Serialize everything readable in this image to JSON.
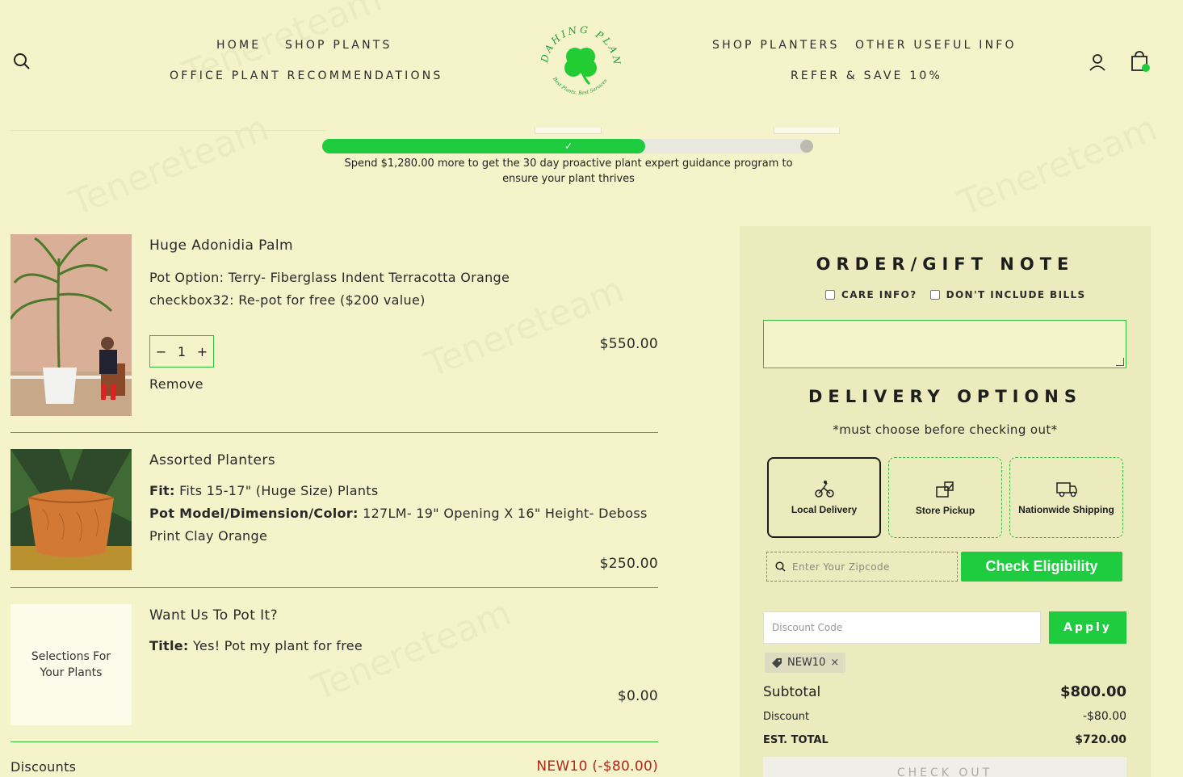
{
  "header": {
    "nav_left": [
      "HOME",
      "SHOP PLANTS",
      "OFFICE PLANT RECOMMENDATIONS"
    ],
    "nav_right": [
      "SHOP PLANTERS",
      "OTHER USEFUL INFO",
      "REFER & SAVE 10%"
    ],
    "logo_text_top": "DAHING PLANTS",
    "logo_text_bottom": "Best Plants, Best Services"
  },
  "progress": {
    "fill_fraction": 0.66,
    "message": "Spend $1,280.00 more to get the 30 day proactive plant expert guidance program to ensure your plant thrives"
  },
  "items": [
    {
      "title": "Huge Adonidia Palm",
      "lines": [
        "Pot Option: Terry- Fiberglass Indent Terracotta Orange",
        "checkbox32: Re-pot for free ($200 value)"
      ],
      "qty": "1",
      "remove": "Remove",
      "price": "$550.00"
    },
    {
      "title": "Assorted Planters",
      "fit_label": "Fit:",
      "fit_value": "Fits 15-17\" (Huge Size) Plants",
      "model_label": "Pot Model/Dimension/Color:",
      "model_value": "127LM- 19\" Opening X 16\" Height- Deboss",
      "model_value2": "Print Clay Orange",
      "price": "$250.00"
    },
    {
      "title": "Want Us To Pot It?",
      "thumb_text": "Selections For Your Plants",
      "title_label": "Title:",
      "title_value": "Yes! Pot my plant for free",
      "price": "$0.00"
    }
  ],
  "discounts": {
    "label": "Discounts",
    "value": "NEW10 (-$80.00)"
  },
  "panel": {
    "note_heading": "ORDER/GIFT NOTE",
    "care_info": "CARE INFO?",
    "dont_include": "DON'T INCLUDE BILLS",
    "delivery_heading": "DELIVERY OPTIONS",
    "delivery_sub": "*must choose before checking out*",
    "options": [
      "Local Delivery",
      "Store Pickup",
      "Nationwide Shipping"
    ],
    "zip_placeholder": "Enter Your Zipcode",
    "check_btn": "Check Eligibility",
    "discount_placeholder": "Discount Code",
    "apply_btn": "Apply",
    "tag": "NEW10",
    "subtotal_label": "Subtotal",
    "subtotal": "$800.00",
    "discount_label": "Discount",
    "discount": "-$80.00",
    "total_label": "EST. TOTAL",
    "total": "$720.00",
    "checkout": "CHECK OUT"
  },
  "colors": {
    "accent": "#1fcc3f",
    "background": "#f5f3c9",
    "panel": "#ecebbd",
    "discount_red": "#b3261e"
  }
}
